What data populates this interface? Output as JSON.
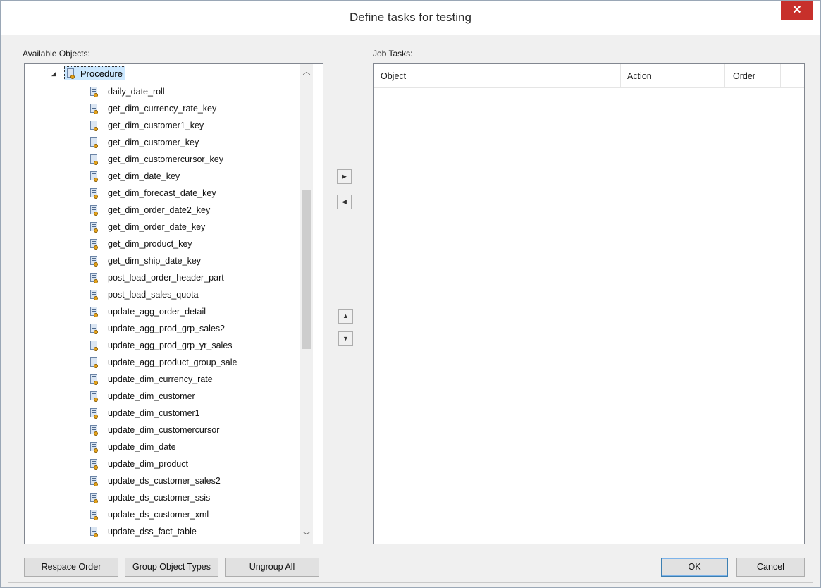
{
  "window": {
    "title": "Define tasks for testing",
    "close_glyph": "✕"
  },
  "available": {
    "label": "Available Objects:",
    "root": {
      "expander": "◢",
      "label": "Procedure",
      "icon": "procedure-icon"
    },
    "items": [
      "daily_date_roll",
      "get_dim_currency_rate_key",
      "get_dim_customer1_key",
      "get_dim_customer_key",
      "get_dim_customercursor_key",
      "get_dim_date_key",
      "get_dim_forecast_date_key",
      "get_dim_order_date2_key",
      "get_dim_order_date_key",
      "get_dim_product_key",
      "get_dim_ship_date_key",
      "post_load_order_header_part",
      "post_load_sales_quota",
      "update_agg_order_detail",
      "update_agg_prod_grp_sales2",
      "update_agg_prod_grp_yr_sales",
      "update_agg_product_group_sale",
      "update_dim_currency_rate",
      "update_dim_customer",
      "update_dim_customer1",
      "update_dim_customercursor",
      "update_dim_date",
      "update_dim_product",
      "update_ds_customer_sales2",
      "update_ds_customer_ssis",
      "update_ds_customer_xml",
      "update_dss_fact_table"
    ],
    "scroll_up": "︿",
    "scroll_down": "﹀"
  },
  "transfer": {
    "add_glyph": "▶",
    "remove_glyph": "◀",
    "up_glyph": "▲",
    "down_glyph": "▼"
  },
  "jobs": {
    "label": "Job Tasks:",
    "columns": [
      "Object",
      "Action",
      "Order"
    ]
  },
  "buttons": {
    "respace": "Respace Order",
    "group": "Group Object Types",
    "ungroup": "Ungroup All",
    "ok": "OK",
    "cancel": "Cancel"
  }
}
